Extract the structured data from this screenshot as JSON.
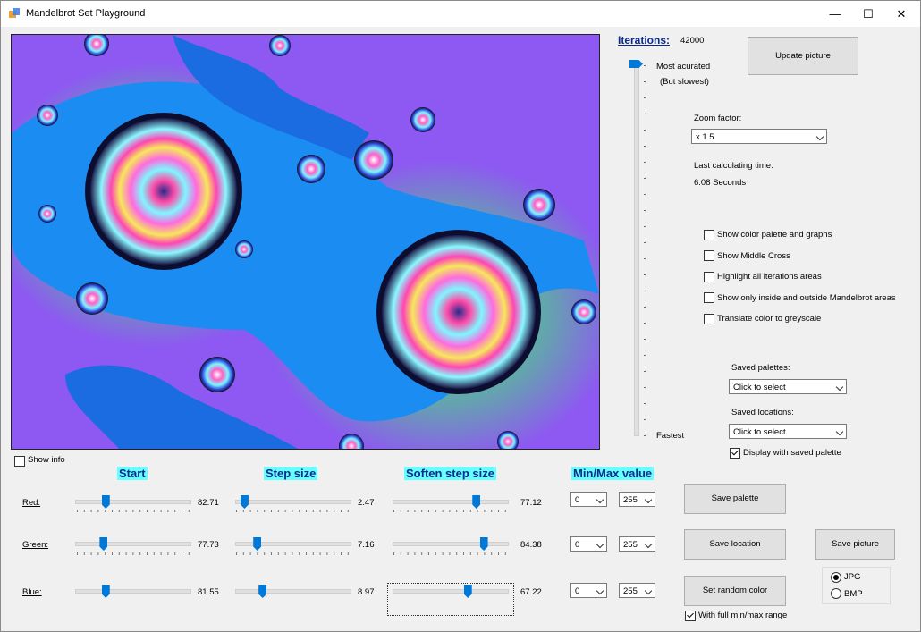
{
  "window": {
    "title": "Mandelbrot Set Playground",
    "min": "—",
    "max": "☐",
    "close": "✕"
  },
  "iterations": {
    "label": "Iterations:",
    "value": "42000",
    "top_label": "Most acurated",
    "top_sub": "(But slowest)",
    "bottom_label": "Fastest",
    "level": 1.0
  },
  "update_button": "Update picture",
  "zoom": {
    "label": "Zoom factor:",
    "value": "x 1.5"
  },
  "calc": {
    "label": "Last calculating time:",
    "value": "6.08 Seconds"
  },
  "options": [
    {
      "label": "Show color palette and graphs",
      "checked": false
    },
    {
      "label": "Show Middle Cross",
      "checked": false
    },
    {
      "label": "Highlight all iterations areas",
      "checked": false
    },
    {
      "label": "Show only inside and outside Mandelbrot areas",
      "checked": false
    },
    {
      "label": "Translate color to greyscale",
      "checked": false
    }
  ],
  "saved_palettes": {
    "label": "Saved palettes:",
    "value": "Click to select"
  },
  "saved_locations": {
    "label": "Saved locations:",
    "value": "Click to select"
  },
  "display_saved_palette": {
    "label": "Display with saved palette",
    "checked": true
  },
  "show_info": {
    "label": "Show info",
    "checked": false
  },
  "headers": {
    "start": "Start",
    "step": "Step size",
    "soften": "Soften step size",
    "minmax": "Min/Max value"
  },
  "rows": [
    {
      "label": "Red:",
      "start": "82.71",
      "start_pos": 0.25,
      "step": "2.47",
      "step_pos": 0.05,
      "soften": "77.12",
      "soften_pos": 0.75,
      "min": "0",
      "max": "255"
    },
    {
      "label": "Green:",
      "start": "77.73",
      "start_pos": 0.23,
      "step": "7.16",
      "step_pos": 0.17,
      "soften": "84.38",
      "soften_pos": 0.82,
      "min": "0",
      "max": "255"
    },
    {
      "label": "Blue:",
      "start": "81.55",
      "start_pos": 0.25,
      "step": "8.97",
      "step_pos": 0.22,
      "soften": "67.22",
      "soften_pos": 0.67,
      "min": "0",
      "max": "255"
    }
  ],
  "buttons": {
    "save_palette": "Save  palette",
    "save_location": "Save location",
    "save_picture": "Save picture",
    "random_color": "Set random color"
  },
  "full_range": {
    "label": "With full min/max range",
    "checked": true
  },
  "format": [
    {
      "label": "JPG",
      "checked": true
    },
    {
      "label": "BMP",
      "checked": false
    }
  ]
}
